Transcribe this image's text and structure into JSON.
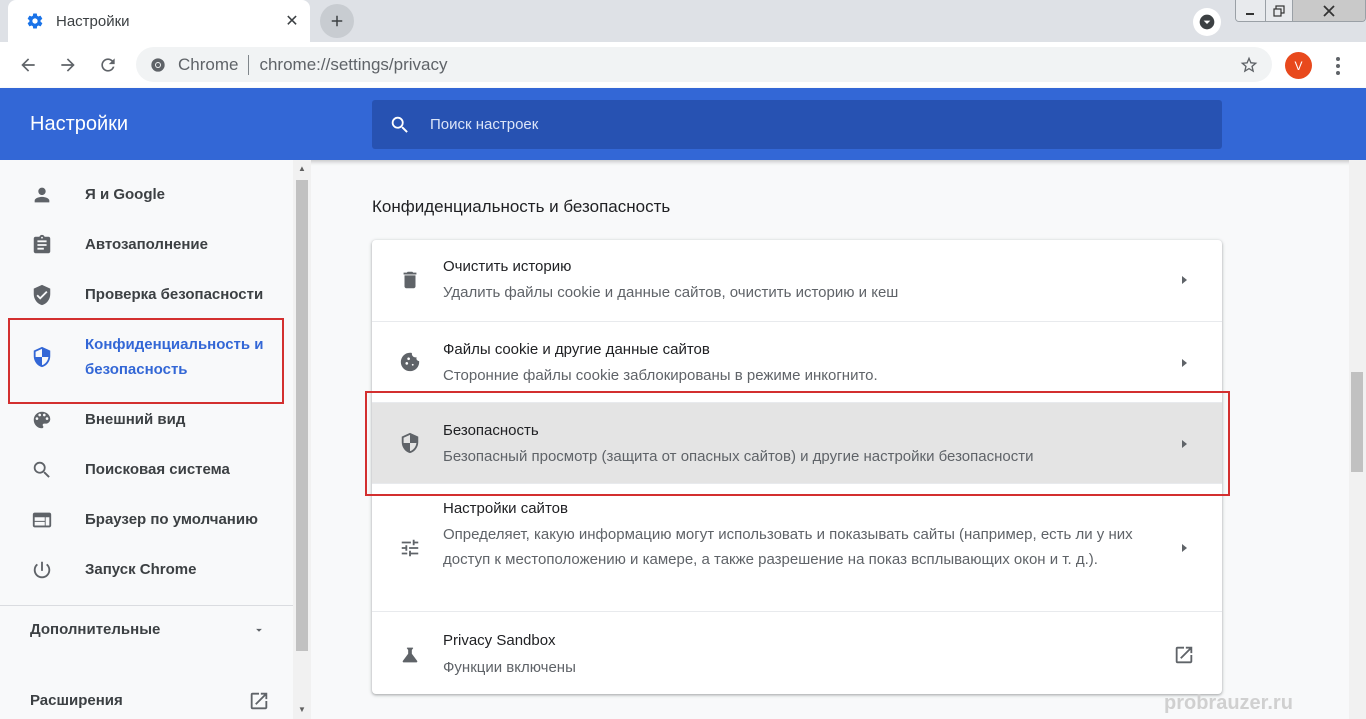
{
  "tab": {
    "title": "Настройки",
    "close": "✕"
  },
  "omnibox": {
    "chrome_label": "Chrome",
    "url_scheme": "chrome://",
    "url_path": "settings/privacy"
  },
  "profile": {
    "initial": "V",
    "color": "#e8491d"
  },
  "header": {
    "title": "Настройки",
    "search_placeholder": "Поиск настроек"
  },
  "sidebar": {
    "items": [
      {
        "label": "Я и Google",
        "icon": "person-icon"
      },
      {
        "label": "Автозаполнение",
        "icon": "clipboard-icon"
      },
      {
        "label": "Проверка безопасности",
        "icon": "shield-check-icon"
      },
      {
        "label_line1": "Конфиденциальность и",
        "label_line2": "безопасность",
        "icon": "shield-icon",
        "active": true
      },
      {
        "label": "Внешний вид",
        "icon": "palette-icon"
      },
      {
        "label": "Поисковая система",
        "icon": "search-icon"
      },
      {
        "label": "Браузер по умолчанию",
        "icon": "browser-icon"
      },
      {
        "label": "Запуск Chrome",
        "icon": "power-icon"
      }
    ],
    "advanced": "Дополнительные",
    "extensions": "Расширения"
  },
  "main": {
    "section_title": "Конфиденциальность и безопасность",
    "rows": [
      {
        "title": "Очистить историю",
        "subtitle": "Удалить файлы cookie и данные сайтов, очистить историю и кеш",
        "icon": "trash-icon"
      },
      {
        "title": "Файлы cookie и другие данные сайтов",
        "subtitle": "Сторонние файлы cookie заблокированы в режиме инкогнито.",
        "icon": "cookie-icon"
      },
      {
        "title": "Безопасность",
        "subtitle": "Безопасный просмотр (защита от опасных сайтов) и другие настройки безопасности",
        "icon": "shield-icon",
        "highlighted": true
      },
      {
        "title": "Настройки сайтов",
        "subtitle": "Определяет, какую информацию могут использовать и показывать сайты (например, есть ли у них доступ к местоположению и камере, а также разрешение на показ всплывающих окон и т. д.).",
        "icon": "tune-icon"
      },
      {
        "title": "Privacy Sandbox",
        "subtitle": "Функции включены",
        "icon": "flask-icon"
      }
    ]
  },
  "watermark": "probrauzer.ru",
  "colors": {
    "accent": "#3367d6",
    "header": "#3367d6",
    "highlight_border": "#d32f2f"
  }
}
